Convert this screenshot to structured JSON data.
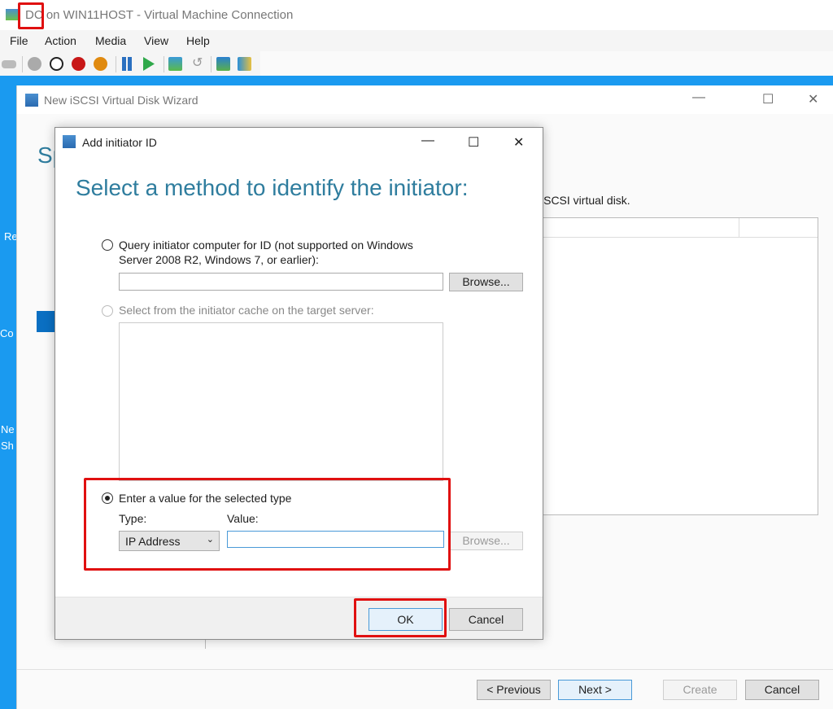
{
  "vm_window": {
    "title": "DC on WIN11HOST - Virtual Machine Connection",
    "menu": [
      "File",
      "Action",
      "Media",
      "View",
      "Help"
    ]
  },
  "desktop": {
    "icons": [
      "Re",
      "Co",
      "Ne",
      "Sh"
    ]
  },
  "wizard": {
    "title": "New iSCSI Virtual Disk Wizard",
    "heading_partial": "Sp",
    "description_partial": "iSCSI virtual disk.",
    "buttons": {
      "previous": "< Previous",
      "next": "Next >",
      "create": "Create",
      "cancel": "Cancel"
    }
  },
  "dialog": {
    "title": "Add initiator ID",
    "heading": "Select a method to identify the initiator:",
    "option_query": {
      "label": "Query initiator computer for ID (not supported on Windows Server 2008 R2, Windows 7, or earlier):",
      "value": "",
      "browse": "Browse...",
      "selected": false
    },
    "option_cache": {
      "label": "Select from the initiator cache on the target server:",
      "enabled": false,
      "items": []
    },
    "option_value": {
      "label": "Enter a value for the selected type",
      "selected": true,
      "type_label": "Type:",
      "type_value": "IP Address",
      "value_label": "Value:",
      "value": "",
      "browse": "Browse..."
    },
    "ok": "OK",
    "cancel": "Cancel"
  },
  "colors": {
    "desktop": "#1a9af0",
    "heading": "#2f7d9e",
    "highlight": "#e01010"
  }
}
